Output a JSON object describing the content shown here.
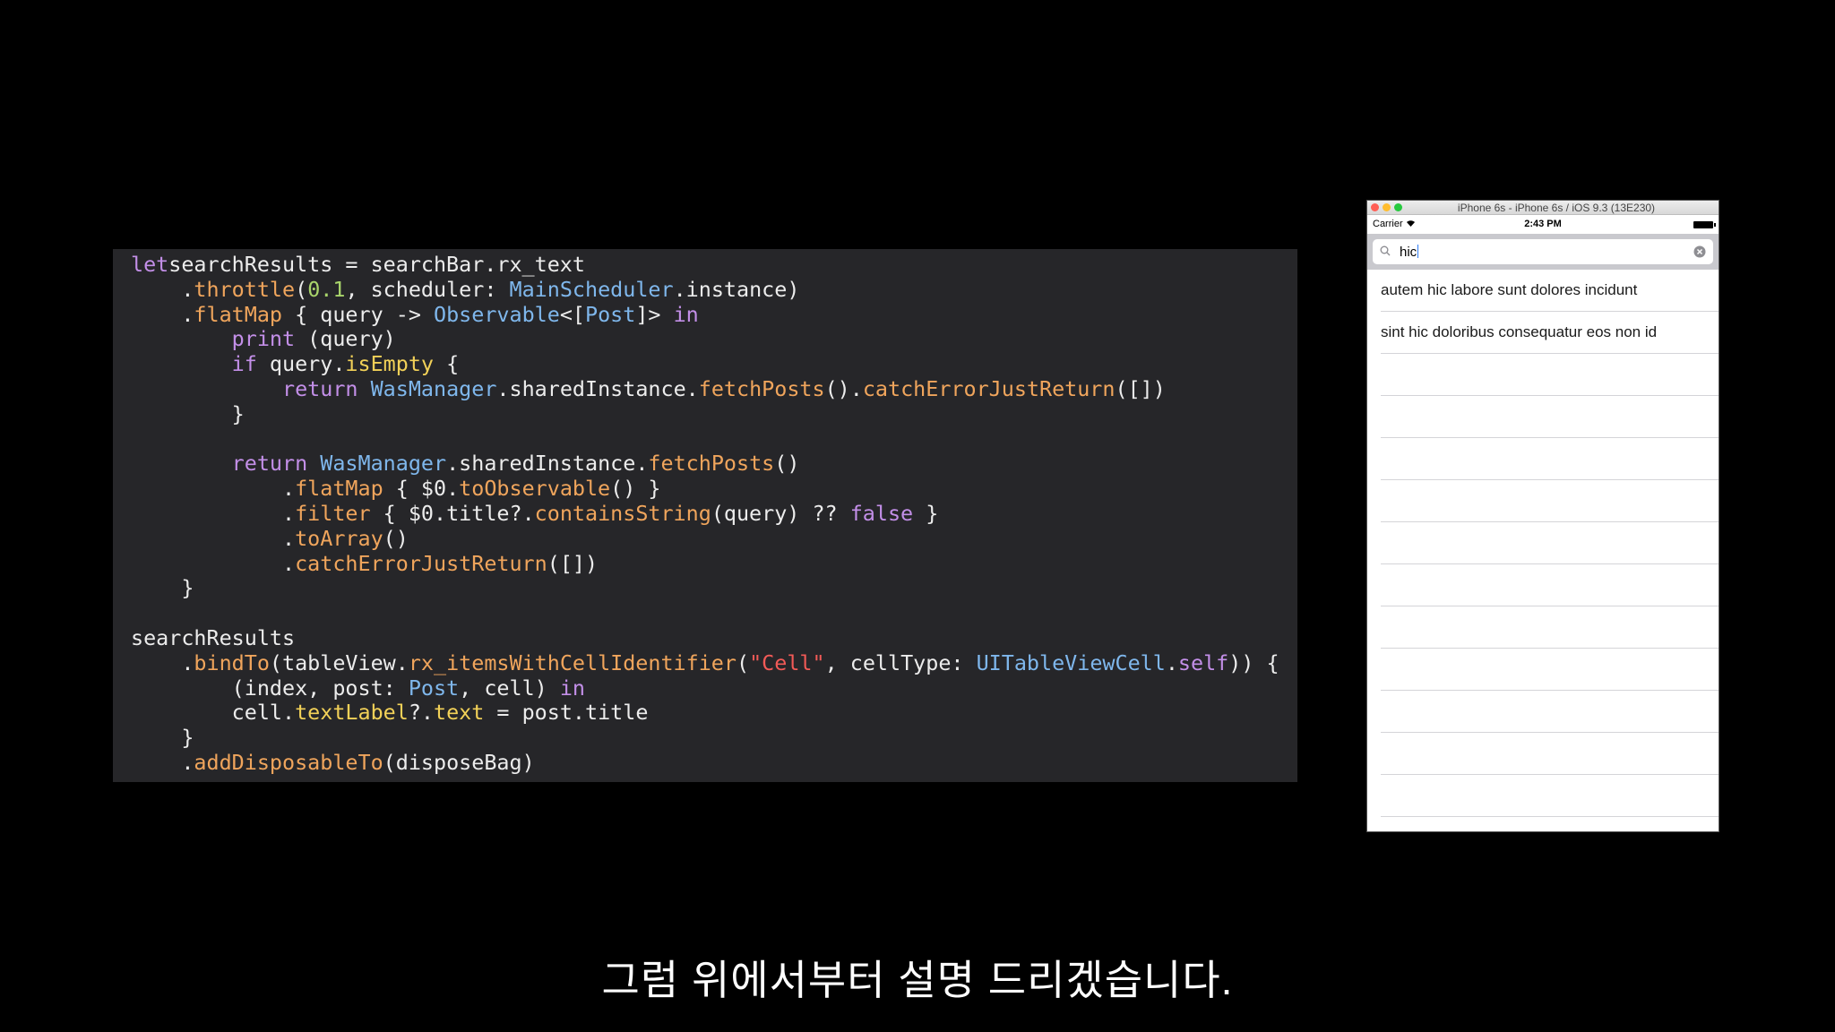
{
  "code": {
    "lines": [
      [
        [
          "kw",
          "let"
        ],
        [
          "",
          "searchResults = searchBar.rx_text"
        ]
      ],
      [
        [
          "",
          "    ."
        ],
        [
          "fn",
          "throttle"
        ],
        [
          "",
          "("
        ],
        [
          "num",
          "0.1"
        ],
        [
          "",
          ", scheduler: "
        ],
        [
          "ty",
          "MainScheduler"
        ],
        [
          "",
          ".instance)"
        ]
      ],
      [
        [
          "",
          "    ."
        ],
        [
          "fn",
          "flatMap"
        ],
        [
          "",
          " { query -> "
        ],
        [
          "ty",
          "Observable"
        ],
        [
          "",
          "<["
        ],
        [
          "ty",
          "Post"
        ],
        [
          "",
          "]> "
        ],
        [
          "kw",
          "in"
        ]
      ],
      [
        [
          "",
          "        "
        ],
        [
          "kw",
          "print"
        ],
        [
          "",
          " (query)"
        ]
      ],
      [
        [
          "",
          "        "
        ],
        [
          "kw",
          "if"
        ],
        [
          "",
          " query."
        ],
        [
          "prop",
          "isEmpty"
        ],
        [
          "",
          " {"
        ]
      ],
      [
        [
          "",
          "            "
        ],
        [
          "kw",
          "return"
        ],
        [
          " ",
          ""
        ],
        [
          "ty",
          "WasManager"
        ],
        [
          "",
          ".sharedInstance."
        ],
        [
          "fn",
          "fetchPosts"
        ],
        [
          "",
          "()."
        ],
        [
          "fn",
          "catchErrorJustReturn"
        ],
        [
          "",
          "([])"
        ]
      ],
      [
        [
          "",
          "        }"
        ]
      ],
      [
        [
          "",
          ""
        ]
      ],
      [
        [
          "",
          "        "
        ],
        [
          "kw",
          "return"
        ],
        [
          "",
          " "
        ],
        [
          "ty",
          "WasManager"
        ],
        [
          "",
          ".sharedInstance."
        ],
        [
          "fn",
          "fetchPosts"
        ],
        [
          "",
          "()"
        ]
      ],
      [
        [
          "",
          "            ."
        ],
        [
          "fn",
          "flatMap"
        ],
        [
          "",
          " { $0."
        ],
        [
          "fn",
          "toObservable"
        ],
        [
          "",
          "() }"
        ]
      ],
      [
        [
          "",
          "            ."
        ],
        [
          "fn",
          "filter"
        ],
        [
          "",
          " { $0.title?."
        ],
        [
          "fn",
          "containsString"
        ],
        [
          "",
          "(query) ?? "
        ],
        [
          "kw",
          "false"
        ],
        [
          "",
          " }"
        ]
      ],
      [
        [
          "",
          "            ."
        ],
        [
          "fn",
          "toArray"
        ],
        [
          "",
          "()"
        ]
      ],
      [
        [
          "",
          "            ."
        ],
        [
          "fn",
          "catchErrorJustReturn"
        ],
        [
          "",
          "([])"
        ]
      ],
      [
        [
          "",
          "    }"
        ]
      ],
      [
        [
          "",
          ""
        ]
      ],
      [
        [
          "",
          "searchResults"
        ]
      ],
      [
        [
          "",
          "    ."
        ],
        [
          "fn",
          "bindTo"
        ],
        [
          "",
          "(tableView."
        ],
        [
          "fn",
          "rx_itemsWithCellIdentifier"
        ],
        [
          "",
          "("
        ],
        [
          "str",
          "\"Cell\""
        ],
        [
          "",
          ", cellType: "
        ],
        [
          "ty",
          "UITableViewCell"
        ],
        [
          "",
          "."
        ],
        [
          "kw",
          "self"
        ],
        [
          "",
          ")) {"
        ]
      ],
      [
        [
          "",
          "        (index, post: "
        ],
        [
          "ty",
          "Post"
        ],
        [
          "",
          ", cell) "
        ],
        [
          "kw",
          "in"
        ]
      ],
      [
        [
          "",
          "        cell."
        ],
        [
          "prop",
          "textLabel"
        ],
        [
          "",
          "?."
        ],
        [
          "prop",
          "text"
        ],
        [
          "",
          " = post.title"
        ]
      ],
      [
        [
          "",
          "    }"
        ]
      ],
      [
        [
          "",
          "    ."
        ],
        [
          "fn",
          "addDisposableTo"
        ],
        [
          "",
          "(disposeBag)"
        ]
      ]
    ]
  },
  "simulator": {
    "title": "iPhone 6s - iPhone 6s / iOS 9.3 (13E230)",
    "carrier": "Carrier",
    "time": "2:43 PM",
    "search_value": "hic",
    "results": [
      "autem hic labore sunt dolores incidunt",
      "sint hic doloribus consequatur eos non id",
      "",
      "",
      "",
      "",
      "",
      "",
      "",
      "",
      "",
      "",
      ""
    ]
  },
  "subtitle": "그럼 위에서부터 설명 드리겠습니다.",
  "colors": {
    "keyword": "#c38fe8",
    "function": "#f0a55c",
    "type": "#7fb7ec",
    "number": "#a9d56b",
    "string": "#f25a57",
    "property": "#f2d158"
  }
}
